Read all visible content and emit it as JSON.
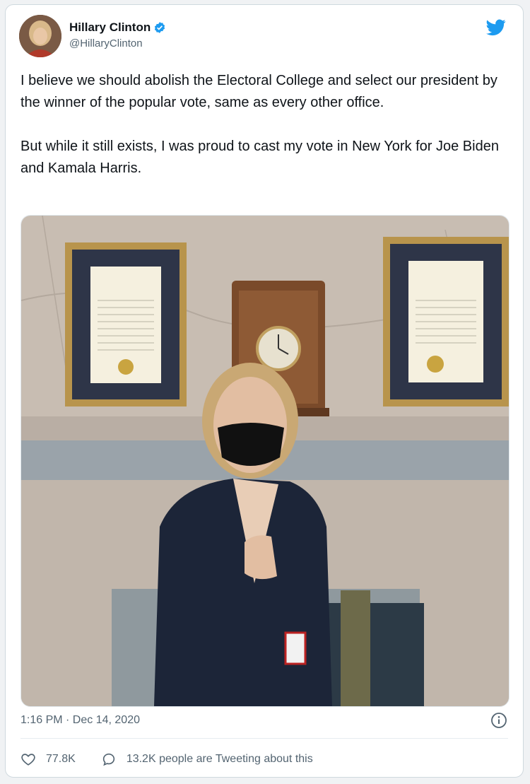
{
  "tweet": {
    "author_name": "Hillary Clinton",
    "author_handle": "@HillaryClinton",
    "text": "I believe we should abolish the Electoral College and select our president by the winner of the popular vote, same as every other office.\n\nBut while it still exists, I was proud to cast my vote in New York for Joe Biden and Kamala Harris.",
    "timestamp": "1:16 PM · Dec 14, 2020",
    "like_count": "77.8K",
    "conversation_text": "13.2K people are Tweeting about this"
  },
  "icons": {
    "verified": "verified-badge-icon",
    "platform": "twitter-bird-icon",
    "info": "info-icon",
    "like": "heart-icon",
    "reply": "speech-bubble-icon"
  },
  "colors": {
    "brand_blue": "#1d9bf0",
    "text_primary": "#0f1419",
    "text_secondary": "#536471"
  }
}
